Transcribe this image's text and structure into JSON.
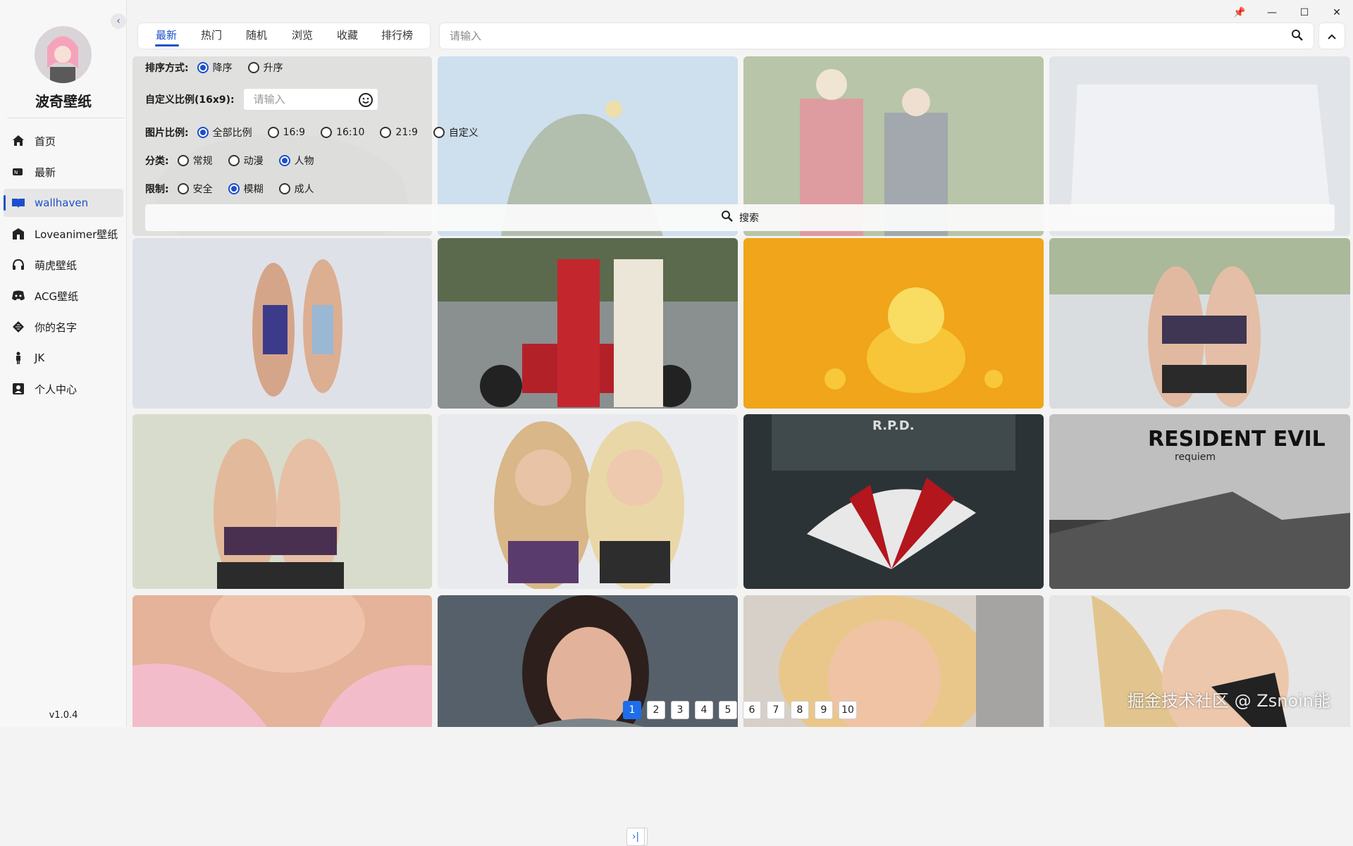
{
  "app": {
    "title": "波奇壁纸",
    "version": "v1.0.4"
  },
  "window_controls": {
    "pin": "pin-icon",
    "minimize": "minimize-icon",
    "maximize": "maximize-icon",
    "close": "close-icon"
  },
  "sidebar": {
    "items": [
      {
        "label": "首页",
        "icon": "home-icon"
      },
      {
        "label": "最新",
        "icon": "new-icon"
      },
      {
        "label": "wallhaven",
        "icon": "book-icon",
        "active": true
      },
      {
        "label": "Loveanimer壁纸",
        "icon": "school-icon"
      },
      {
        "label": "萌虎壁纸",
        "icon": "headset-icon"
      },
      {
        "label": "ACG壁纸",
        "icon": "discord-icon"
      },
      {
        "label": "你的名字",
        "icon": "layers-icon"
      },
      {
        "label": "JK",
        "icon": "person-icon"
      },
      {
        "label": "个人中心",
        "icon": "contact-icon"
      }
    ]
  },
  "tabs": [
    "最新",
    "热门",
    "随机",
    "浏览",
    "收藏",
    "排行榜"
  ],
  "search": {
    "placeholder": "请输入"
  },
  "filters": {
    "sort": {
      "label": "排序方式:",
      "options": [
        "降序",
        "升序"
      ],
      "selected": 0
    },
    "custom_ratio": {
      "label": "自定义比例(16x9):",
      "placeholder": "请输入"
    },
    "ratio": {
      "label": "图片比例:",
      "options": [
        "全部比例",
        "16:9",
        "16:10",
        "21:9",
        "自定义"
      ],
      "selected": 0
    },
    "category": {
      "label": "分类:",
      "options": [
        "常规",
        "动漫",
        "人物"
      ],
      "selected": 2
    },
    "purity": {
      "label": "限制:",
      "options": [
        "安全",
        "模糊",
        "成人"
      ],
      "selected": 1
    },
    "search_button": "搜索"
  },
  "resident_evil": {
    "title": "RESIDENT EVIL",
    "subtitle": "requiem",
    "rpd": "R.P.D."
  },
  "pagination": {
    "pages": [
      "1",
      "2",
      "3",
      "4",
      "5",
      "6",
      "7",
      "8",
      "9",
      "10"
    ],
    "current": 0,
    "next": "›",
    "last": "›|"
  },
  "watermark": "掘金技术社区 @ Zsnoin能",
  "colors": {
    "accent": "#1d4fcc",
    "page_active": "#1d6ee8"
  }
}
